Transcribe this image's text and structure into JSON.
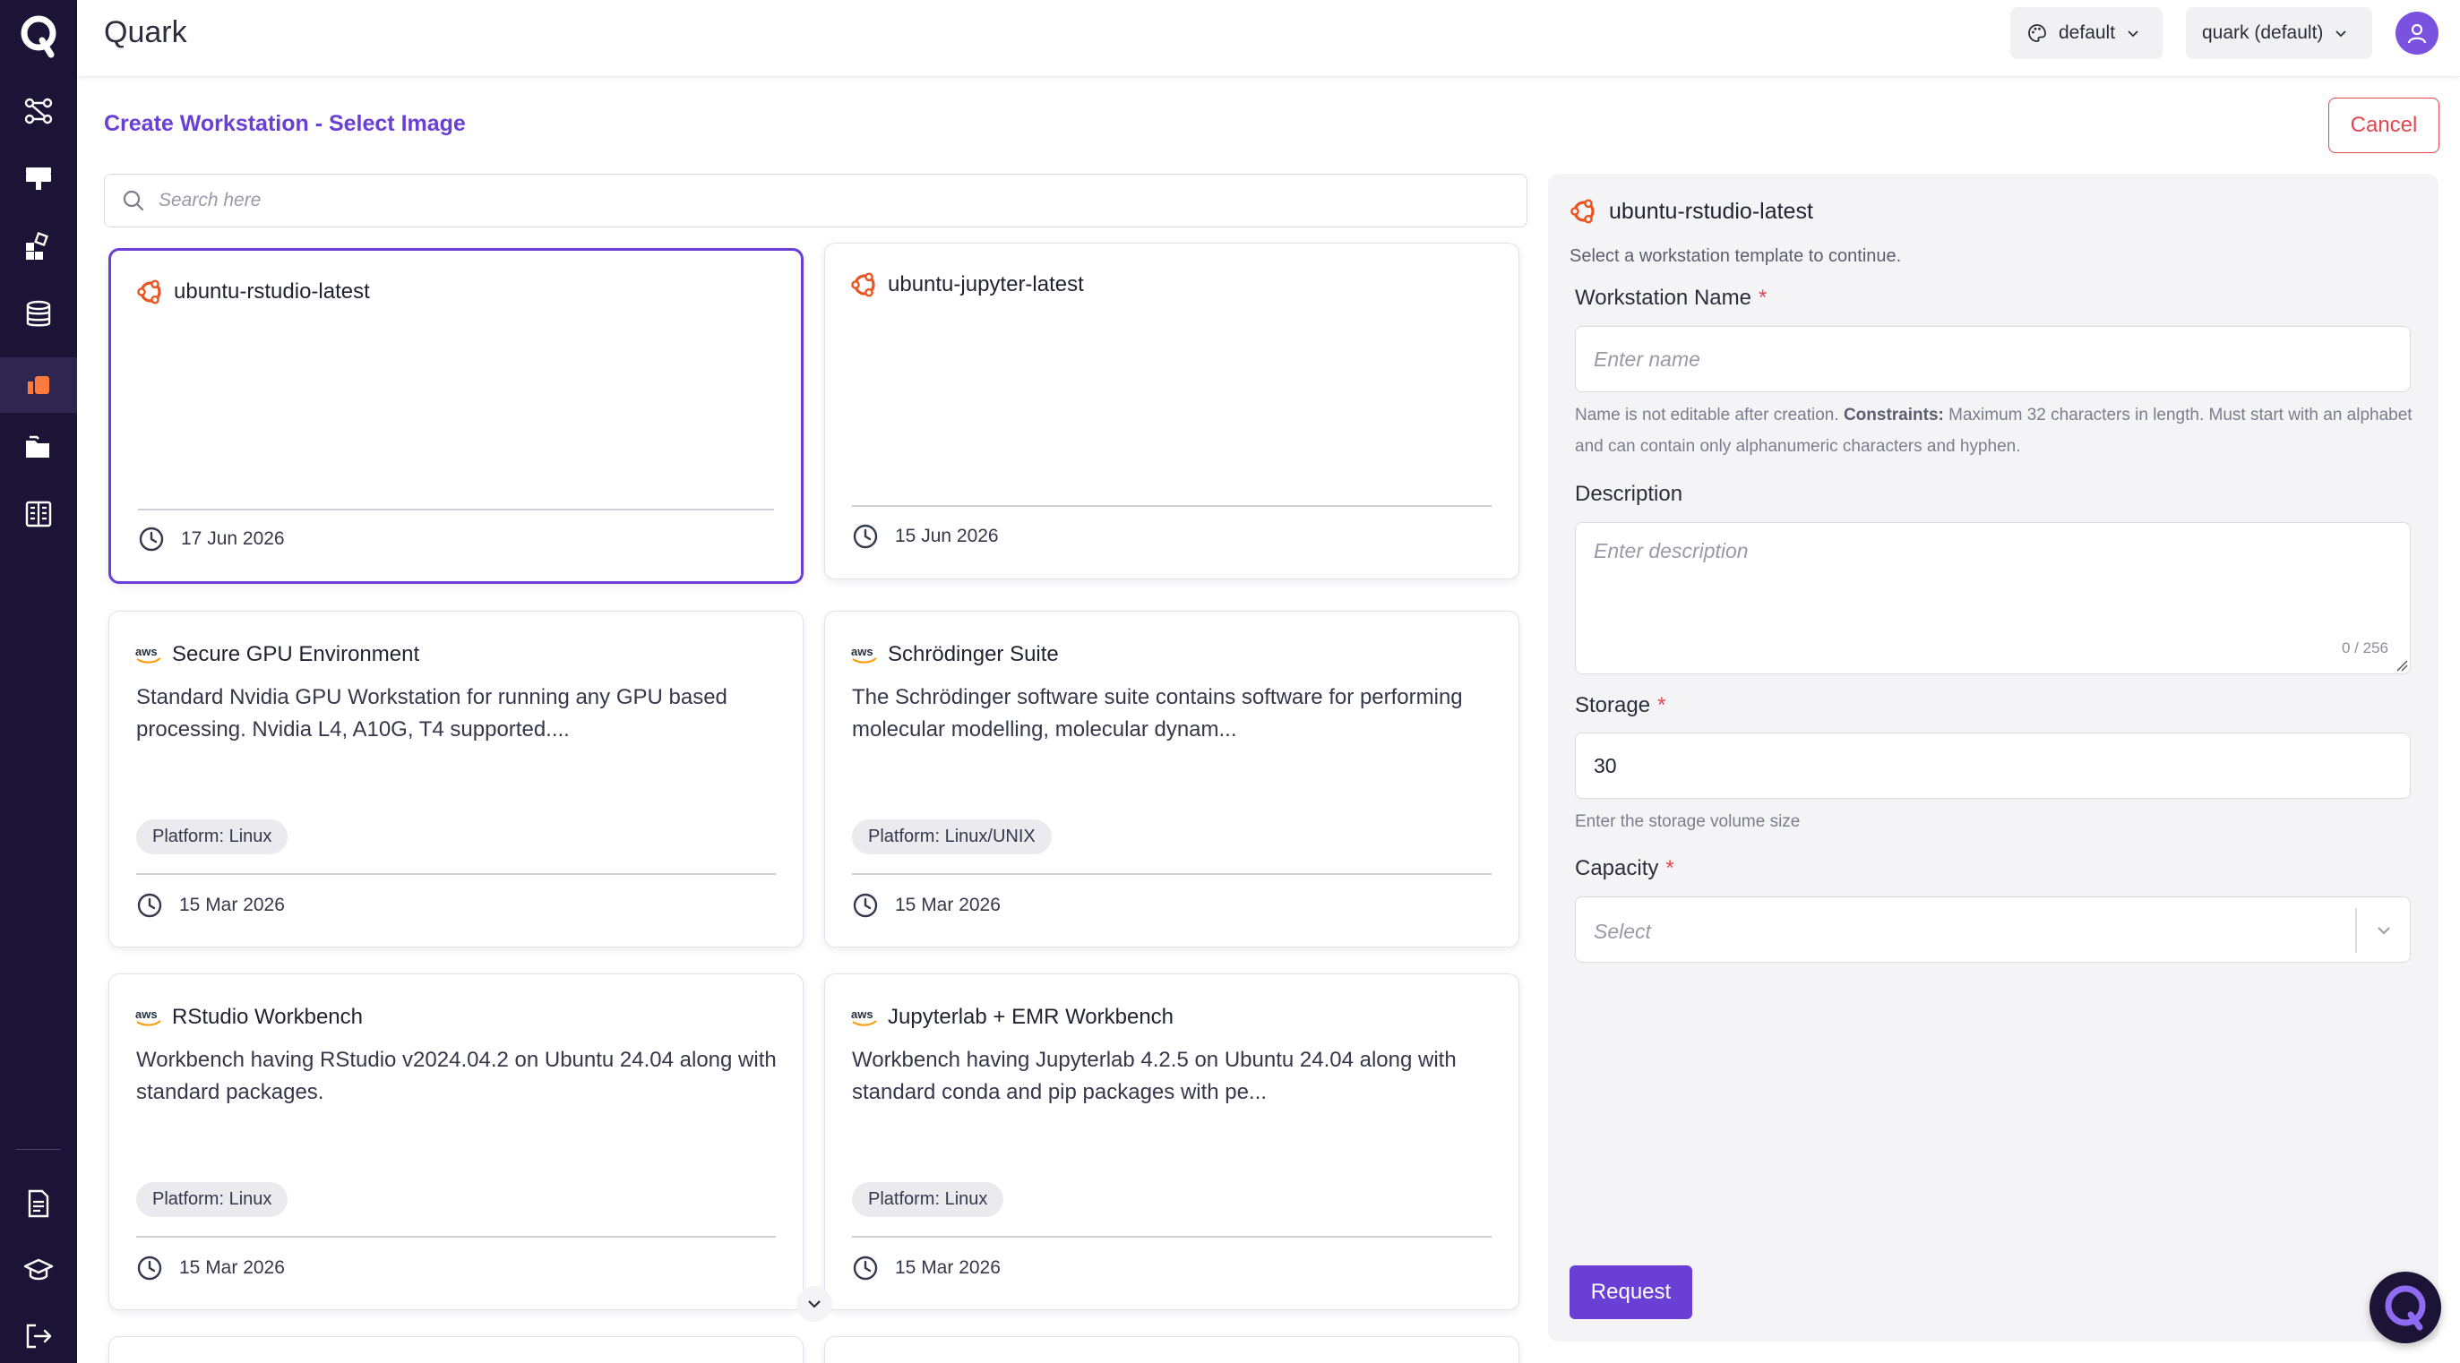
{
  "app": {
    "title": "Quark"
  },
  "header": {
    "theme_select": "default",
    "project_select": "quark (default)"
  },
  "sidebar": {
    "items": [
      {
        "icon": "workflow-icon"
      },
      {
        "icon": "desktop-icon"
      },
      {
        "icon": "apps-icon"
      },
      {
        "icon": "database-icon"
      },
      {
        "icon": "workstations-icon",
        "active": true
      },
      {
        "icon": "folders-icon"
      },
      {
        "icon": "notebook-icon"
      },
      {
        "icon": "document-icon"
      },
      {
        "icon": "graduation-cap-icon"
      },
      {
        "icon": "logout-icon"
      }
    ]
  },
  "page": {
    "title": "Create Workstation - Select Image",
    "cancel_label": "Cancel"
  },
  "search": {
    "placeholder": "Search here",
    "value": ""
  },
  "cards": [
    {
      "provider": "ubuntu",
      "title": "ubuntu-rstudio-latest",
      "description": "",
      "tag": "",
      "date": "17 Jun 2026",
      "selected": true
    },
    {
      "provider": "ubuntu",
      "title": "ubuntu-jupyter-latest",
      "description": "",
      "tag": "",
      "date": "15 Jun 2026",
      "selected": false
    },
    {
      "provider": "aws",
      "title": "Secure GPU Environment",
      "description": "Standard Nvidia GPU Workstation for running any GPU based processing. Nvidia L4, A10G, T4 supported....",
      "tag": "Platform: Linux",
      "date": "15 Mar 2026"
    },
    {
      "provider": "aws",
      "title": "Schrödinger Suite",
      "description": "The Schrödinger software suite contains software for performing molecular modelling, molecular dynam...",
      "tag": "Platform: Linux/UNIX",
      "date": "15 Mar 2026"
    },
    {
      "provider": "aws",
      "title": "RStudio Workbench",
      "description": "Workbench having RStudio v2024.04.2 on Ubuntu 24.04 along with standard packages.",
      "tag": "Platform: Linux",
      "date": "15 Mar 2026"
    },
    {
      "provider": "aws",
      "title": "Jupyterlab + EMR Workbench",
      "description": "Workbench having Jupyterlab 4.2.5 on Ubuntu 24.04 along with standard conda and pip packages with pe...",
      "tag": "Platform: Linux",
      "date": "15 Mar 2026"
    }
  ],
  "panel": {
    "title": "ubuntu-rstudio-latest",
    "subtitle": "Select a workstation template to continue.",
    "name_label": "Workstation Name",
    "name_placeholder": "Enter name",
    "name_help_prefix": "Name is not editable after creation. ",
    "name_help_bold": "Constraints:",
    "name_help_suffix": " Maximum 32 characters in length. Must start with an alphabet and can contain only alphanumeric characters and hyphen.",
    "description_label": "Description",
    "description_placeholder": "Enter description",
    "description_counter": "0 / 256",
    "storage_label": "Storage",
    "storage_value": "30",
    "storage_help": "Enter the storage volume size",
    "capacity_label": "Capacity",
    "capacity_placeholder": "Select",
    "request_label": "Request"
  },
  "colors": {
    "accent": "#6a3fd6",
    "sidebar": "#1b1437",
    "danger": "#e3464f",
    "ubuntu": "#e95420",
    "aws": "#ff9900"
  }
}
